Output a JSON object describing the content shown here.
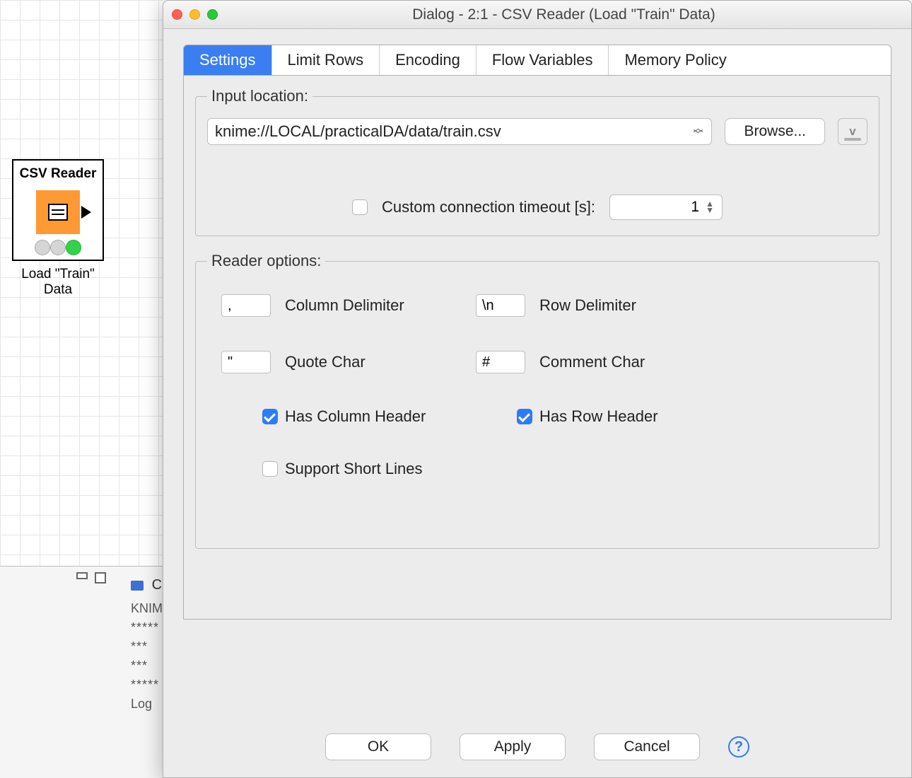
{
  "workspace": {
    "node_title": "CSV Reader",
    "node_label": "Load \"Train\" Data"
  },
  "console": {
    "tab_letter": "C",
    "line1": "KNIM",
    "line2": "*****",
    "line3": "***",
    "line4": "***",
    "line5": "*****",
    "line6": "Log"
  },
  "dialog": {
    "title": "Dialog - 2:1 - CSV Reader (Load \"Train\" Data)",
    "tabs": [
      "Settings",
      "Limit Rows",
      "Encoding",
      "Flow Variables",
      "Memory Policy"
    ],
    "active_tab": 0,
    "input_location": {
      "legend": "Input location:",
      "path": "knime://LOCAL/practicalDA/data/train.csv",
      "browse": "Browse...",
      "timeout_label": "Custom connection timeout [s]:",
      "timeout_value": "1",
      "timeout_checked": false
    },
    "reader_options": {
      "legend": "Reader options:",
      "col_delim": ",",
      "col_delim_label": "Column Delimiter",
      "row_delim": "\\n",
      "row_delim_label": "Row Delimiter",
      "quote_char": "\"",
      "quote_char_label": "Quote Char",
      "comment_char": "#",
      "comment_char_label": "Comment Char",
      "has_col_header_label": "Has Column Header",
      "has_col_header": true,
      "has_row_header_label": "Has Row Header",
      "has_row_header": true,
      "support_short_label": "Support Short Lines",
      "support_short": false
    },
    "buttons": {
      "ok": "OK",
      "apply": "Apply",
      "cancel": "Cancel"
    }
  }
}
